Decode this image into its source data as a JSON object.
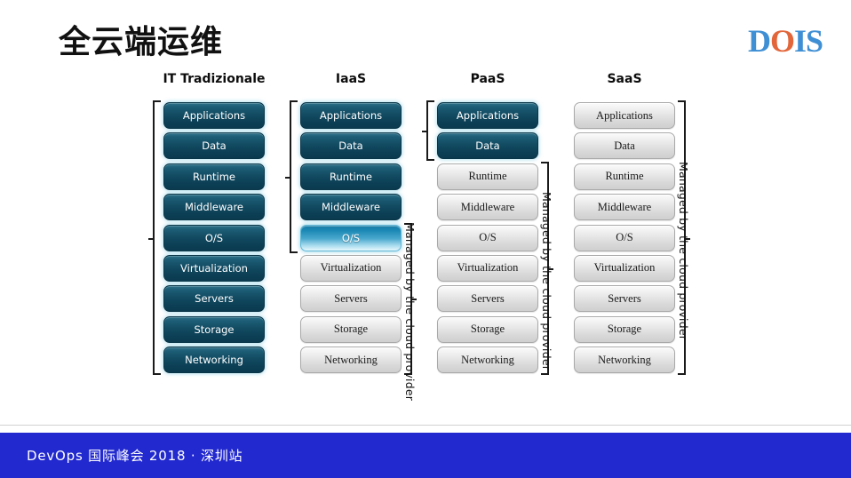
{
  "slide": {
    "title": "全云端运维",
    "logo": {
      "part1": "D",
      "part2": "O",
      "part3": "IS"
    }
  },
  "footer": {
    "text": "DevOps 国际峰会 2018 · 深圳站",
    "bar_color": "#2229ce"
  },
  "colors": {
    "teal": "#124b62",
    "highlight": "#49a8cd",
    "grey": "#d9d9d9",
    "logo_blue": "#3f8fd4",
    "logo_orange": "#e2663a",
    "footer_blue": "#2229ce"
  },
  "diagram": {
    "managed_label": "Managed by the cloud provider",
    "layers": [
      "Applications",
      "Data",
      "Runtime",
      "Middleware",
      "O/S",
      "Virtualization",
      "Servers",
      "Storage",
      "Networking"
    ],
    "columns": [
      {
        "header": "IT Tradizionale",
        "styles": [
          "teal",
          "teal",
          "teal",
          "teal",
          "teal",
          "teal",
          "teal",
          "teal",
          "teal"
        ],
        "user_bracket": {
          "from": 0,
          "to": 8
        },
        "provider_bracket": null,
        "managed_label": null
      },
      {
        "header": "IaaS",
        "styles": [
          "teal",
          "teal",
          "teal",
          "teal",
          "highlight",
          "grey",
          "grey",
          "grey",
          "grey"
        ],
        "user_bracket": {
          "from": 0,
          "to": 4
        },
        "provider_bracket": {
          "from": 4,
          "to": 8
        },
        "managed_label": "Managed by the cloud provider"
      },
      {
        "header": "PaaS",
        "styles": [
          "teal",
          "teal",
          "grey",
          "grey",
          "grey",
          "grey",
          "grey",
          "grey",
          "grey"
        ],
        "user_bracket": {
          "from": 0,
          "to": 1
        },
        "provider_bracket": {
          "from": 2,
          "to": 8
        },
        "managed_label": "Managed by the cloud provider"
      },
      {
        "header": "SaaS",
        "styles": [
          "grey",
          "grey",
          "grey",
          "grey",
          "grey",
          "grey",
          "grey",
          "grey",
          "grey"
        ],
        "user_bracket": null,
        "provider_bracket": {
          "from": 0,
          "to": 8
        },
        "managed_label": "Managed by the cloud provider"
      }
    ]
  }
}
